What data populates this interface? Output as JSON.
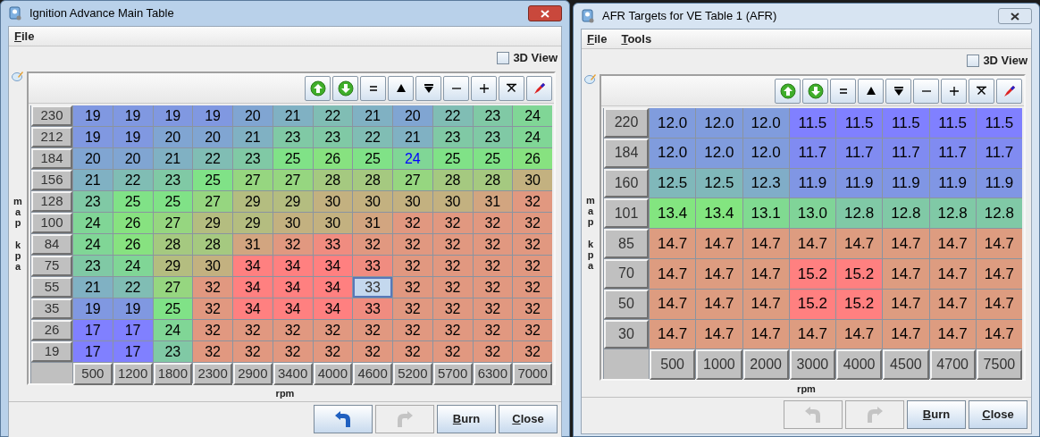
{
  "windows": [
    {
      "title": "Ignition Advance Main Table",
      "active": true,
      "menu": [
        "File"
      ],
      "view_3d": {
        "label": "3D View",
        "checked": false
      },
      "y_axis_label": "map kpa",
      "x_axis_label": "rpm",
      "rows": [
        {
          "label": "230",
          "cells": [
            {
              "value": "19",
              "selected": false,
              "modified": false
            },
            {
              "value": "19",
              "selected": false,
              "modified": false
            },
            {
              "value": "19",
              "selected": false,
              "modified": false
            },
            {
              "value": "19",
              "selected": false,
              "modified": false
            },
            {
              "value": "20",
              "selected": false,
              "modified": false
            },
            {
              "value": "21",
              "selected": false,
              "modified": false
            },
            {
              "value": "22",
              "selected": false,
              "modified": false
            },
            {
              "value": "21",
              "selected": false,
              "modified": false
            },
            {
              "value": "20",
              "selected": false,
              "modified": false
            },
            {
              "value": "22",
              "selected": false,
              "modified": false
            },
            {
              "value": "23",
              "selected": false,
              "modified": false
            },
            {
              "value": "24",
              "selected": false,
              "modified": false
            }
          ]
        },
        {
          "label": "212",
          "cells": [
            {
              "value": "19",
              "selected": false,
              "modified": false
            },
            {
              "value": "19",
              "selected": false,
              "modified": false
            },
            {
              "value": "20",
              "selected": false,
              "modified": false
            },
            {
              "value": "20",
              "selected": false,
              "modified": false
            },
            {
              "value": "21",
              "selected": false,
              "modified": false
            },
            {
              "value": "23",
              "selected": false,
              "modified": false
            },
            {
              "value": "23",
              "selected": false,
              "modified": false
            },
            {
              "value": "22",
              "selected": false,
              "modified": false
            },
            {
              "value": "21",
              "selected": false,
              "modified": false
            },
            {
              "value": "23",
              "selected": false,
              "modified": false
            },
            {
              "value": "23",
              "selected": false,
              "modified": false
            },
            {
              "value": "24",
              "selected": false,
              "modified": false
            }
          ]
        },
        {
          "label": "184",
          "cells": [
            {
              "value": "20",
              "selected": false,
              "modified": false
            },
            {
              "value": "20",
              "selected": false,
              "modified": false
            },
            {
              "value": "21",
              "selected": false,
              "modified": false
            },
            {
              "value": "22",
              "selected": false,
              "modified": false
            },
            {
              "value": "23",
              "selected": false,
              "modified": false
            },
            {
              "value": "25",
              "selected": false,
              "modified": false
            },
            {
              "value": "26",
              "selected": false,
              "modified": false
            },
            {
              "value": "25",
              "selected": false,
              "modified": false
            },
            {
              "value": "24",
              "selected": false,
              "modified": true
            },
            {
              "value": "25",
              "selected": false,
              "modified": false
            },
            {
              "value": "25",
              "selected": false,
              "modified": false
            },
            {
              "value": "26",
              "selected": false,
              "modified": false
            }
          ]
        },
        {
          "label": "156",
          "cells": [
            {
              "value": "21",
              "selected": false,
              "modified": false
            },
            {
              "value": "22",
              "selected": false,
              "modified": false
            },
            {
              "value": "23",
              "selected": false,
              "modified": false
            },
            {
              "value": "25",
              "selected": false,
              "modified": false
            },
            {
              "value": "27",
              "selected": false,
              "modified": false
            },
            {
              "value": "27",
              "selected": false,
              "modified": false
            },
            {
              "value": "28",
              "selected": false,
              "modified": false
            },
            {
              "value": "28",
              "selected": false,
              "modified": false
            },
            {
              "value": "27",
              "selected": false,
              "modified": false
            },
            {
              "value": "28",
              "selected": false,
              "modified": false
            },
            {
              "value": "28",
              "selected": false,
              "modified": false
            },
            {
              "value": "30",
              "selected": false,
              "modified": false
            }
          ]
        },
        {
          "label": "128",
          "cells": [
            {
              "value": "23",
              "selected": false,
              "modified": false
            },
            {
              "value": "25",
              "selected": false,
              "modified": false
            },
            {
              "value": "25",
              "selected": false,
              "modified": false
            },
            {
              "value": "27",
              "selected": false,
              "modified": false
            },
            {
              "value": "29",
              "selected": false,
              "modified": false
            },
            {
              "value": "29",
              "selected": false,
              "modified": false
            },
            {
              "value": "30",
              "selected": false,
              "modified": false
            },
            {
              "value": "30",
              "selected": false,
              "modified": false
            },
            {
              "value": "30",
              "selected": false,
              "modified": false
            },
            {
              "value": "30",
              "selected": false,
              "modified": false
            },
            {
              "value": "31",
              "selected": false,
              "modified": false
            },
            {
              "value": "32",
              "selected": false,
              "modified": false
            }
          ]
        },
        {
          "label": "100",
          "cells": [
            {
              "value": "24",
              "selected": false,
              "modified": false
            },
            {
              "value": "26",
              "selected": false,
              "modified": false
            },
            {
              "value": "27",
              "selected": false,
              "modified": false
            },
            {
              "value": "29",
              "selected": false,
              "modified": false
            },
            {
              "value": "29",
              "selected": false,
              "modified": false
            },
            {
              "value": "30",
              "selected": false,
              "modified": false
            },
            {
              "value": "30",
              "selected": false,
              "modified": false
            },
            {
              "value": "31",
              "selected": false,
              "modified": false
            },
            {
              "value": "32",
              "selected": false,
              "modified": false
            },
            {
              "value": "32",
              "selected": false,
              "modified": false
            },
            {
              "value": "32",
              "selected": false,
              "modified": false
            },
            {
              "value": "32",
              "selected": false,
              "modified": false
            }
          ]
        },
        {
          "label": "84",
          "cells": [
            {
              "value": "24",
              "selected": false,
              "modified": false
            },
            {
              "value": "26",
              "selected": false,
              "modified": false
            },
            {
              "value": "28",
              "selected": false,
              "modified": false
            },
            {
              "value": "28",
              "selected": false,
              "modified": false
            },
            {
              "value": "31",
              "selected": false,
              "modified": false
            },
            {
              "value": "32",
              "selected": false,
              "modified": false
            },
            {
              "value": "33",
              "selected": false,
              "modified": false
            },
            {
              "value": "32",
              "selected": false,
              "modified": false
            },
            {
              "value": "32",
              "selected": false,
              "modified": false
            },
            {
              "value": "32",
              "selected": false,
              "modified": false
            },
            {
              "value": "32",
              "selected": false,
              "modified": false
            },
            {
              "value": "32",
              "selected": false,
              "modified": false
            }
          ]
        },
        {
          "label": "75",
          "cells": [
            {
              "value": "23",
              "selected": false,
              "modified": false
            },
            {
              "value": "24",
              "selected": false,
              "modified": false
            },
            {
              "value": "29",
              "selected": false,
              "modified": false
            },
            {
              "value": "30",
              "selected": false,
              "modified": false
            },
            {
              "value": "34",
              "selected": false,
              "modified": false
            },
            {
              "value": "34",
              "selected": false,
              "modified": false
            },
            {
              "value": "34",
              "selected": false,
              "modified": false
            },
            {
              "value": "33",
              "selected": false,
              "modified": false
            },
            {
              "value": "32",
              "selected": false,
              "modified": false
            },
            {
              "value": "32",
              "selected": false,
              "modified": false
            },
            {
              "value": "32",
              "selected": false,
              "modified": false
            },
            {
              "value": "32",
              "selected": false,
              "modified": false
            }
          ]
        },
        {
          "label": "55",
          "cells": [
            {
              "value": "21",
              "selected": false,
              "modified": false
            },
            {
              "value": "22",
              "selected": false,
              "modified": false
            },
            {
              "value": "27",
              "selected": false,
              "modified": false
            },
            {
              "value": "32",
              "selected": false,
              "modified": false
            },
            {
              "value": "34",
              "selected": false,
              "modified": false
            },
            {
              "value": "34",
              "selected": false,
              "modified": false
            },
            {
              "value": "34",
              "selected": false,
              "modified": false
            },
            {
              "value": "33",
              "selected": true,
              "modified": false
            },
            {
              "value": "32",
              "selected": false,
              "modified": false
            },
            {
              "value": "32",
              "selected": false,
              "modified": false
            },
            {
              "value": "32",
              "selected": false,
              "modified": false
            },
            {
              "value": "32",
              "selected": false,
              "modified": false
            }
          ]
        },
        {
          "label": "35",
          "cells": [
            {
              "value": "19",
              "selected": false,
              "modified": false
            },
            {
              "value": "19",
              "selected": false,
              "modified": false
            },
            {
              "value": "25",
              "selected": false,
              "modified": false
            },
            {
              "value": "32",
              "selected": false,
              "modified": false
            },
            {
              "value": "34",
              "selected": false,
              "modified": false
            },
            {
              "value": "34",
              "selected": false,
              "modified": false
            },
            {
              "value": "34",
              "selected": false,
              "modified": false
            },
            {
              "value": "33",
              "selected": false,
              "modified": false
            },
            {
              "value": "32",
              "selected": false,
              "modified": false
            },
            {
              "value": "32",
              "selected": false,
              "modified": false
            },
            {
              "value": "32",
              "selected": false,
              "modified": false
            },
            {
              "value": "32",
              "selected": false,
              "modified": false
            }
          ]
        },
        {
          "label": "26",
          "cells": [
            {
              "value": "17",
              "selected": false,
              "modified": false
            },
            {
              "value": "17",
              "selected": false,
              "modified": false
            },
            {
              "value": "24",
              "selected": false,
              "modified": false
            },
            {
              "value": "32",
              "selected": false,
              "modified": false
            },
            {
              "value": "32",
              "selected": false,
              "modified": false
            },
            {
              "value": "32",
              "selected": false,
              "modified": false
            },
            {
              "value": "32",
              "selected": false,
              "modified": false
            },
            {
              "value": "32",
              "selected": false,
              "modified": false
            },
            {
              "value": "32",
              "selected": false,
              "modified": false
            },
            {
              "value": "32",
              "selected": false,
              "modified": false
            },
            {
              "value": "32",
              "selected": false,
              "modified": false
            },
            {
              "value": "32",
              "selected": false,
              "modified": false
            }
          ]
        },
        {
          "label": "19",
          "cells": [
            {
              "value": "17",
              "selected": false,
              "modified": false
            },
            {
              "value": "17",
              "selected": false,
              "modified": false
            },
            {
              "value": "23",
              "selected": false,
              "modified": false
            },
            {
              "value": "32",
              "selected": false,
              "modified": false
            },
            {
              "value": "32",
              "selected": false,
              "modified": false
            },
            {
              "value": "32",
              "selected": false,
              "modified": false
            },
            {
              "value": "32",
              "selected": false,
              "modified": false
            },
            {
              "value": "32",
              "selected": false,
              "modified": false
            },
            {
              "value": "32",
              "selected": false,
              "modified": false
            },
            {
              "value": "32",
              "selected": false,
              "modified": false
            },
            {
              "value": "32",
              "selected": false,
              "modified": false
            },
            {
              "value": "32",
              "selected": false,
              "modified": false
            }
          ]
        }
      ],
      "x_axis_values": [
        "500",
        "1200",
        "1800",
        "2300",
        "2900",
        "3400",
        "4000",
        "4600",
        "5200",
        "5700",
        "6300",
        "7000"
      ],
      "buttons": [
        {
          "kind": "undo",
          "disabled": false
        },
        {
          "kind": "redo",
          "disabled": true
        },
        {
          "kind": "text",
          "label": "Burn",
          "disabled": false
        },
        {
          "kind": "text",
          "label": "Close",
          "disabled": false
        }
      ]
    },
    {
      "title": "AFR Targets for VE Table 1 (AFR)",
      "active": false,
      "menu": [
        "File",
        "Tools"
      ],
      "view_3d": {
        "label": "3D View",
        "checked": false
      },
      "y_axis_label": "map kpa",
      "x_axis_label": "rpm",
      "rows": [
        {
          "label": "220",
          "cells": [
            {
              "value": "12.0",
              "selected": false,
              "modified": false
            },
            {
              "value": "12.0",
              "selected": false,
              "modified": false
            },
            {
              "value": "12.0",
              "selected": false,
              "modified": false
            },
            {
              "value": "11.5",
              "selected": false,
              "modified": false
            },
            {
              "value": "11.5",
              "selected": false,
              "modified": false
            },
            {
              "value": "11.5",
              "selected": false,
              "modified": false
            },
            {
              "value": "11.5",
              "selected": false,
              "modified": false
            },
            {
              "value": "11.5",
              "selected": false,
              "modified": false
            }
          ]
        },
        {
          "label": "184",
          "cells": [
            {
              "value": "12.0",
              "selected": false,
              "modified": false
            },
            {
              "value": "12.0",
              "selected": false,
              "modified": false
            },
            {
              "value": "12.0",
              "selected": false,
              "modified": false
            },
            {
              "value": "11.7",
              "selected": false,
              "modified": false
            },
            {
              "value": "11.7",
              "selected": false,
              "modified": false
            },
            {
              "value": "11.7",
              "selected": false,
              "modified": false
            },
            {
              "value": "11.7",
              "selected": false,
              "modified": false
            },
            {
              "value": "11.7",
              "selected": false,
              "modified": false
            }
          ]
        },
        {
          "label": "160",
          "cells": [
            {
              "value": "12.5",
              "selected": false,
              "modified": false
            },
            {
              "value": "12.5",
              "selected": false,
              "modified": false
            },
            {
              "value": "12.3",
              "selected": false,
              "modified": false
            },
            {
              "value": "11.9",
              "selected": false,
              "modified": false
            },
            {
              "value": "11.9",
              "selected": false,
              "modified": false
            },
            {
              "value": "11.9",
              "selected": false,
              "modified": false
            },
            {
              "value": "11.9",
              "selected": false,
              "modified": false
            },
            {
              "value": "11.9",
              "selected": false,
              "modified": false
            }
          ]
        },
        {
          "label": "101",
          "cells": [
            {
              "value": "13.4",
              "selected": false,
              "modified": false
            },
            {
              "value": "13.4",
              "selected": false,
              "modified": false
            },
            {
              "value": "13.1",
              "selected": false,
              "modified": false
            },
            {
              "value": "13.0",
              "selected": false,
              "modified": false
            },
            {
              "value": "12.8",
              "selected": false,
              "modified": false
            },
            {
              "value": "12.8",
              "selected": false,
              "modified": false
            },
            {
              "value": "12.8",
              "selected": false,
              "modified": false
            },
            {
              "value": "12.8",
              "selected": false,
              "modified": false
            }
          ]
        },
        {
          "label": "85",
          "cells": [
            {
              "value": "14.7",
              "selected": false,
              "modified": false
            },
            {
              "value": "14.7",
              "selected": false,
              "modified": false
            },
            {
              "value": "14.7",
              "selected": false,
              "modified": false
            },
            {
              "value": "14.7",
              "selected": false,
              "modified": false
            },
            {
              "value": "14.7",
              "selected": false,
              "modified": false
            },
            {
              "value": "14.7",
              "selected": false,
              "modified": false
            },
            {
              "value": "14.7",
              "selected": false,
              "modified": false
            },
            {
              "value": "14.7",
              "selected": false,
              "modified": false
            }
          ]
        },
        {
          "label": "70",
          "cells": [
            {
              "value": "14.7",
              "selected": false,
              "modified": false
            },
            {
              "value": "14.7",
              "selected": false,
              "modified": false
            },
            {
              "value": "14.7",
              "selected": false,
              "modified": false
            },
            {
              "value": "15.2",
              "selected": false,
              "modified": false
            },
            {
              "value": "15.2",
              "selected": false,
              "modified": false
            },
            {
              "value": "14.7",
              "selected": false,
              "modified": false
            },
            {
              "value": "14.7",
              "selected": false,
              "modified": false
            },
            {
              "value": "14.7",
              "selected": false,
              "modified": false
            }
          ]
        },
        {
          "label": "50",
          "cells": [
            {
              "value": "14.7",
              "selected": false,
              "modified": false
            },
            {
              "value": "14.7",
              "selected": false,
              "modified": false
            },
            {
              "value": "14.7",
              "selected": false,
              "modified": false
            },
            {
              "value": "15.2",
              "selected": false,
              "modified": false
            },
            {
              "value": "15.2",
              "selected": false,
              "modified": false
            },
            {
              "value": "14.7",
              "selected": false,
              "modified": false
            },
            {
              "value": "14.7",
              "selected": false,
              "modified": false
            },
            {
              "value": "14.7",
              "selected": false,
              "modified": false
            }
          ]
        },
        {
          "label": "30",
          "cells": [
            {
              "value": "14.7",
              "selected": false,
              "modified": false
            },
            {
              "value": "14.7",
              "selected": false,
              "modified": false
            },
            {
              "value": "14.7",
              "selected": false,
              "modified": false
            },
            {
              "value": "14.7",
              "selected": false,
              "modified": false
            },
            {
              "value": "14.7",
              "selected": false,
              "modified": false
            },
            {
              "value": "14.7",
              "selected": false,
              "modified": false
            },
            {
              "value": "14.7",
              "selected": false,
              "modified": false
            },
            {
              "value": "14.7",
              "selected": false,
              "modified": false
            }
          ]
        }
      ],
      "x_axis_values": [
        "500",
        "1000",
        "2000",
        "3000",
        "4000",
        "4500",
        "4700",
        "7500"
      ],
      "buttons": [
        {
          "kind": "undo",
          "disabled": true
        },
        {
          "kind": "redo",
          "disabled": true
        },
        {
          "kind": "text",
          "label": "Burn",
          "disabled": false
        },
        {
          "kind": "text",
          "label": "Close",
          "disabled": false
        }
      ]
    }
  ]
}
